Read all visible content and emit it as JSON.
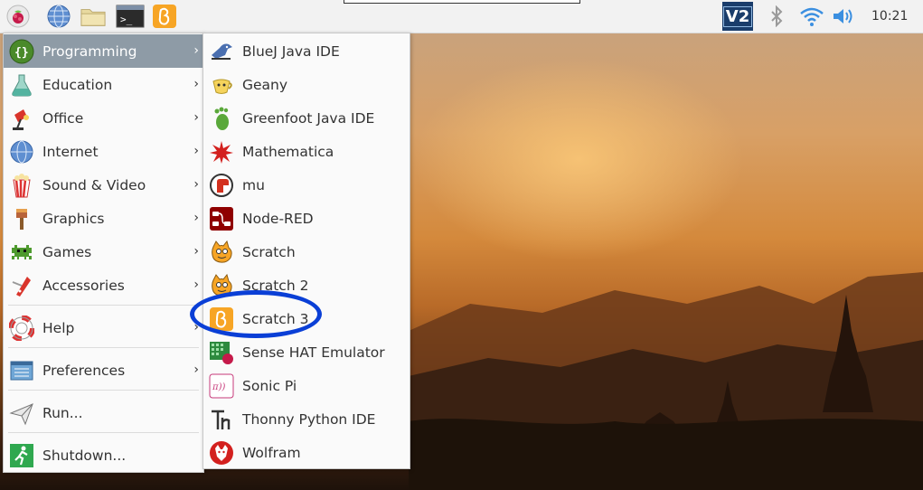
{
  "taskbar": {
    "launchers": [
      "raspberry-menu-icon",
      "web-browser-icon",
      "file-manager-icon",
      "terminal-icon",
      "scratch-3-launcher-icon"
    ],
    "tray": {
      "vnc_label": "V2",
      "clock": "10:21"
    }
  },
  "main_menu": {
    "items": [
      {
        "label": "Programming",
        "icon": "programming-icon",
        "has_submenu": true,
        "selected": true
      },
      {
        "label": "Education",
        "icon": "education-icon",
        "has_submenu": true
      },
      {
        "label": "Office",
        "icon": "office-icon",
        "has_submenu": true
      },
      {
        "label": "Internet",
        "icon": "internet-icon",
        "has_submenu": true
      },
      {
        "label": "Sound & Video",
        "icon": "sound-video-icon",
        "has_submenu": true
      },
      {
        "label": "Graphics",
        "icon": "graphics-icon",
        "has_submenu": true
      },
      {
        "label": "Games",
        "icon": "games-icon",
        "has_submenu": true
      },
      {
        "label": "Accessories",
        "icon": "accessories-icon",
        "has_submenu": true
      },
      {
        "label": "Help",
        "icon": "help-icon",
        "has_submenu": true
      },
      {
        "label": "Preferences",
        "icon": "preferences-icon",
        "has_submenu": true
      },
      {
        "label": "Run...",
        "icon": "run-icon",
        "has_submenu": false
      },
      {
        "label": "Shutdown...",
        "icon": "shutdown-icon",
        "has_submenu": false
      }
    ]
  },
  "programming_submenu": {
    "items": [
      {
        "label": "BlueJ Java IDE",
        "icon": "bluej-icon"
      },
      {
        "label": "Geany",
        "icon": "geany-icon"
      },
      {
        "label": "Greenfoot Java IDE",
        "icon": "greenfoot-icon"
      },
      {
        "label": "Mathematica",
        "icon": "mathematica-icon"
      },
      {
        "label": "mu",
        "icon": "mu-icon"
      },
      {
        "label": "Node-RED",
        "icon": "node-red-icon"
      },
      {
        "label": "Scratch",
        "icon": "scratch-icon"
      },
      {
        "label": "Scratch 2",
        "icon": "scratch-2-icon"
      },
      {
        "label": "Scratch 3",
        "icon": "scratch-3-icon",
        "circled": true
      },
      {
        "label": "Sense HAT Emulator",
        "icon": "sense-hat-icon"
      },
      {
        "label": "Sonic Pi",
        "icon": "sonic-pi-icon"
      },
      {
        "label": "Thonny Python IDE",
        "icon": "thonny-icon"
      },
      {
        "label": "Wolfram",
        "icon": "wolfram-icon"
      }
    ]
  },
  "colors": {
    "menu_selected": "#8e9ba6",
    "highlight_ring": "#0a3fd6",
    "scratch_orange": "#f7a525"
  }
}
